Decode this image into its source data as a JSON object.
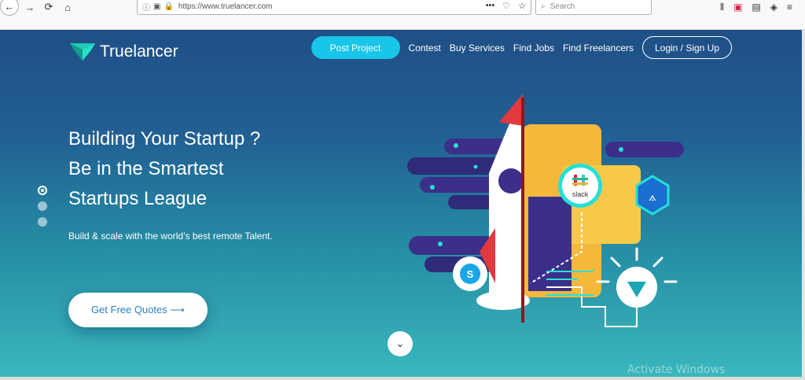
{
  "browser": {
    "url": "https://www.truelancer.com",
    "search_placeholder": "Search"
  },
  "site": {
    "brand": "Truelancer",
    "nav": {
      "post_project": "Post Project",
      "contest": "Contest",
      "buy_services": "Buy Services",
      "find_jobs": "Find Jobs",
      "find_freelancers": "Find Freelancers",
      "login": "Login / Sign Up"
    },
    "hero": {
      "line1": "Building Your Startup ?",
      "line2": "Be in the Smartest",
      "line3": "Startups League",
      "subline": "Build & scale with the world’s best remote Talent.",
      "cta": "Get Free Quotes ⟶"
    },
    "slides": {
      "count": 3,
      "active_index": 0
    },
    "illustration_badges": [
      "slack"
    ]
  },
  "os_overlay": {
    "watermark": "Activate Windows"
  },
  "colors": {
    "hero_top": "#1f4f86",
    "hero_bottom": "#3bb7bd",
    "accent": "#19c5e8"
  }
}
